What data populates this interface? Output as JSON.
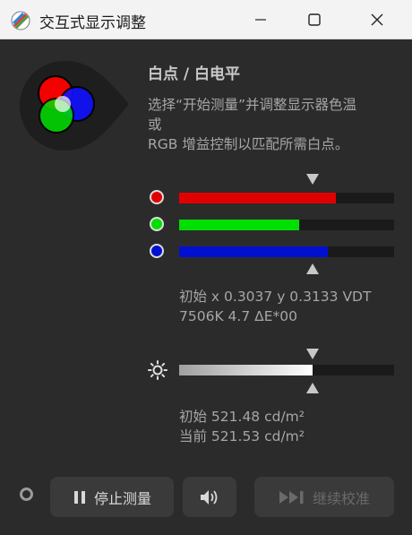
{
  "window": {
    "title": "交互式显示调整"
  },
  "panel": {
    "heading": "白点 / 白电平",
    "desc_line1": "选择“开始测量”并调整显示器色温",
    "desc_line2": "或",
    "desc_line3": "RGB 增益控制以匹配所需白点。"
  },
  "rgb": {
    "red": {
      "color": "#e00000",
      "level": 0.73
    },
    "green": {
      "color": "#00e000",
      "level": 0.56
    },
    "blue": {
      "color": "#0010d0",
      "level": 0.69
    },
    "target_level": 0.62
  },
  "white_point_info": {
    "line1": "初始 x 0.3037 y 0.3133 VDT",
    "line2": "7506K 4.7 ΔE*00"
  },
  "brightness": {
    "level": 0.62,
    "target_level": 0.62
  },
  "luminance_info": {
    "initial": "初始 521.48 cd/m²",
    "current": "当前 521.53 cd/m²"
  },
  "buttons": {
    "stop": "停止测量",
    "resume": "继续校准"
  },
  "icons": [
    "app-icon",
    "minimize-icon",
    "maximize-icon",
    "close-icon",
    "rgb-logo-icon",
    "brightness-icon",
    "pause-icon",
    "speaker-icon",
    "play-skip-icon",
    "status-indicator-icon"
  ]
}
